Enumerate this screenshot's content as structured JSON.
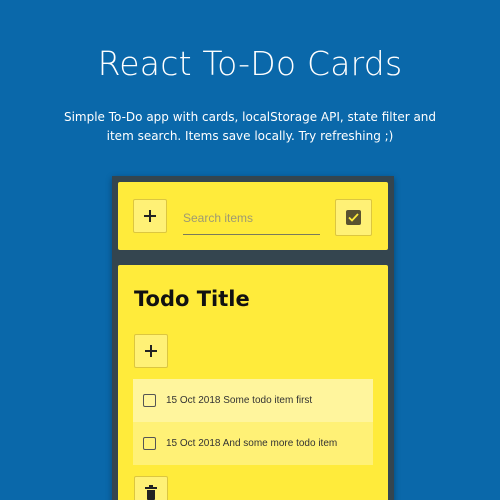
{
  "header": {
    "title": "React To-Do Cards",
    "description": "Simple To-Do app with cards, localStorage API, state filter and item search. Items save locally. Try refreshing ;)"
  },
  "toolbar": {
    "add_icon": "plus-icon",
    "search_placeholder": "Search items",
    "search_value": "",
    "filter_icon": "checkbox-checked-icon"
  },
  "card": {
    "title": "Todo Title",
    "add_icon": "plus-icon",
    "items": [
      {
        "text": "15 Oct 2018 Some todo item first",
        "checked": false
      },
      {
        "text": "15 Oct 2018 And some more todo item",
        "checked": false
      }
    ],
    "delete_icon": "trash-icon"
  },
  "colors": {
    "background": "#0a68aa",
    "panel": "#34454f",
    "card": "#ffeb3b",
    "item_light": "#fff59d",
    "item_dark": "#fff176"
  }
}
